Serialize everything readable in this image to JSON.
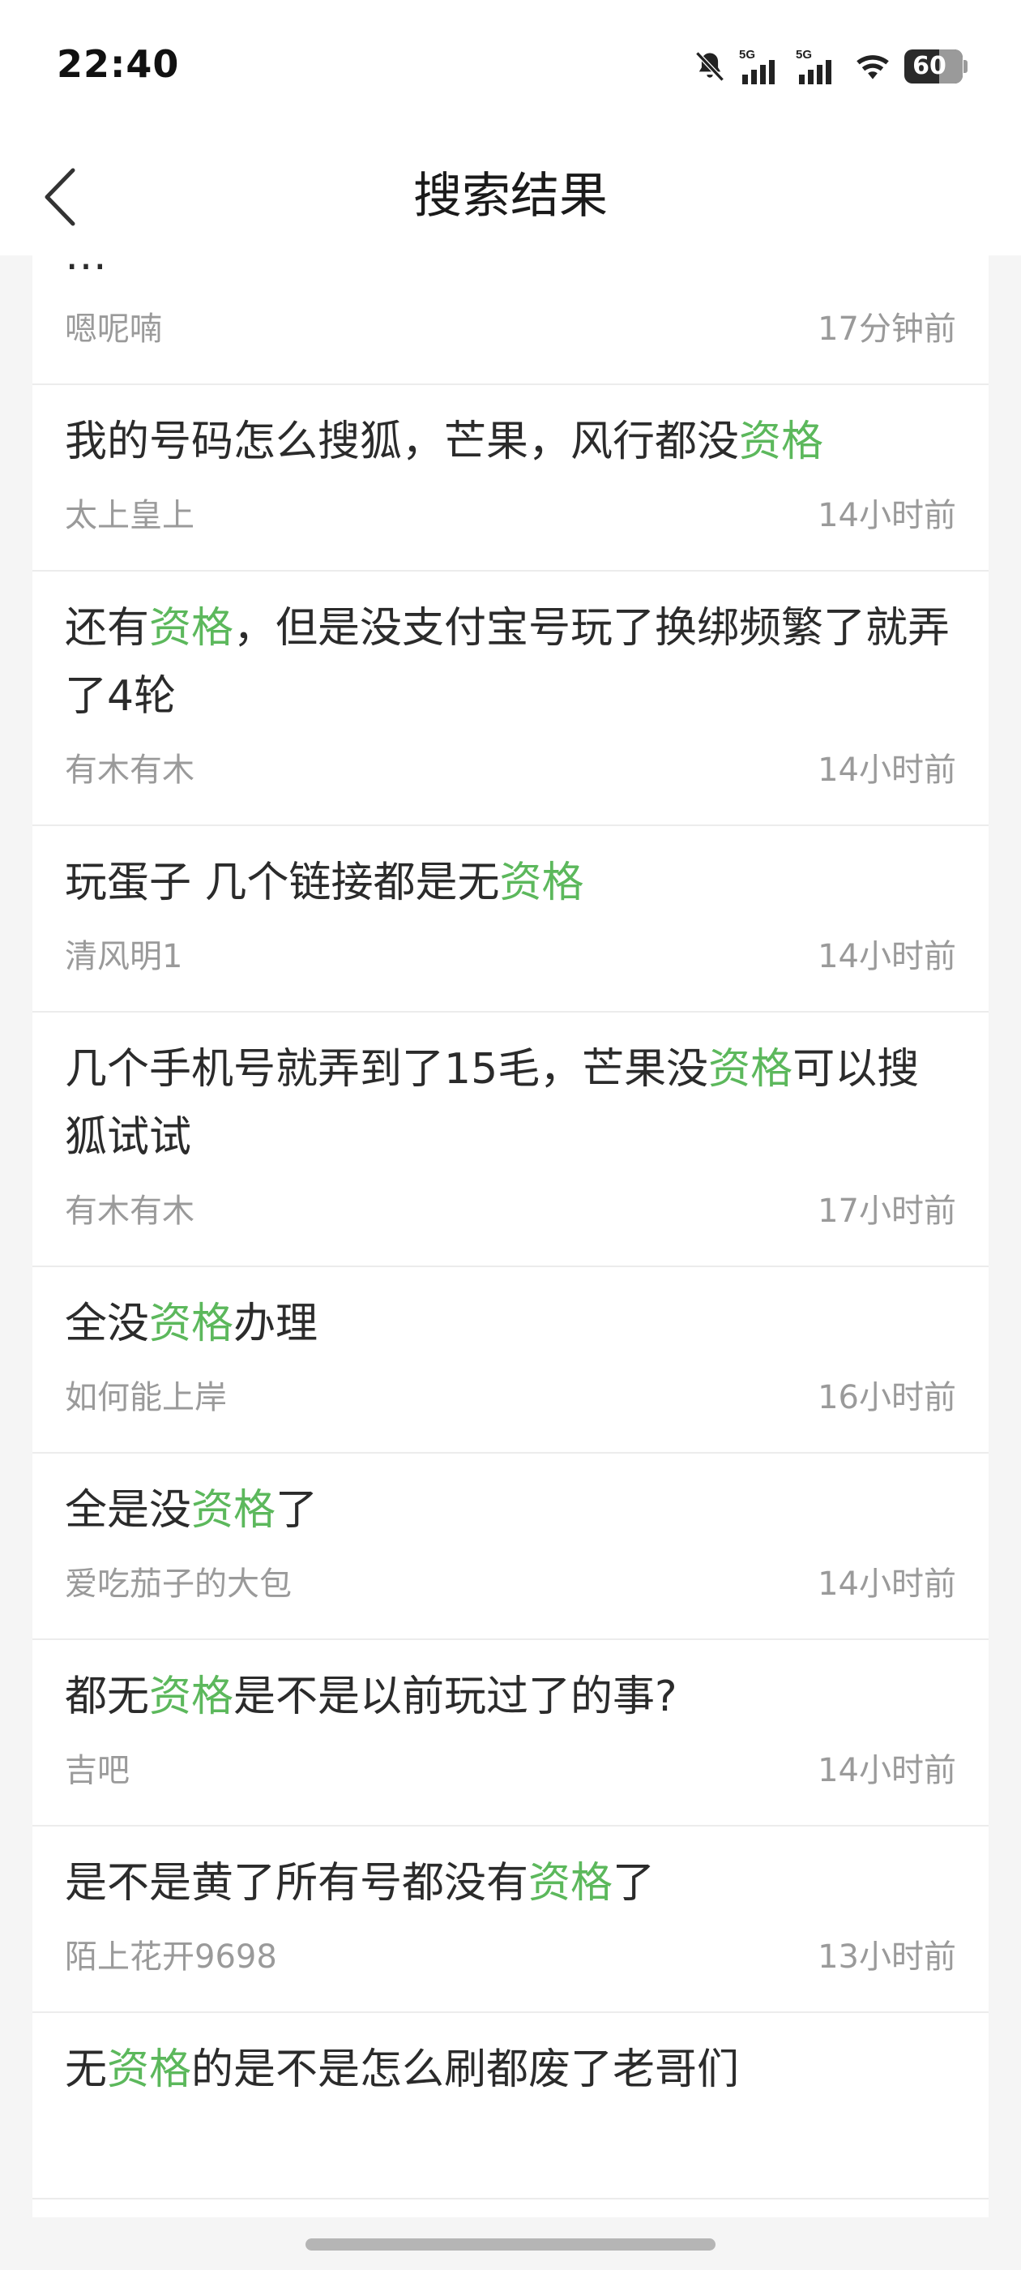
{
  "status_bar": {
    "time": "22:40",
    "network_1": "5G",
    "network_2": "5G",
    "battery": "60"
  },
  "header": {
    "title": "搜索结果"
  },
  "results": [
    {
      "title_parts": [
        {
          "text": "…",
          "hl": false
        }
      ],
      "author": "嗯呢喃",
      "time": "17分钟前"
    },
    {
      "title_parts": [
        {
          "text": "我的号码怎么搜狐，芒果，风行都没",
          "hl": false
        },
        {
          "text": "资格",
          "hl": true
        }
      ],
      "author": "太上皇上",
      "time": "14小时前"
    },
    {
      "title_parts": [
        {
          "text": "还有",
          "hl": false
        },
        {
          "text": "资格",
          "hl": true
        },
        {
          "text": "，但是没支付宝号玩了换绑频繁了就弄了4轮",
          "hl": false
        }
      ],
      "author": "有木有木",
      "time": "14小时前"
    },
    {
      "title_parts": [
        {
          "text": "玩蛋子 几个链接都是无",
          "hl": false
        },
        {
          "text": "资格",
          "hl": true
        }
      ],
      "author": "清风明1",
      "time": "14小时前"
    },
    {
      "title_parts": [
        {
          "text": "几个手机号就弄到了15毛，芒果没",
          "hl": false
        },
        {
          "text": "资格",
          "hl": true
        },
        {
          "text": "可以搜狐试试",
          "hl": false
        }
      ],
      "author": "有木有木",
      "time": "17小时前"
    },
    {
      "title_parts": [
        {
          "text": "全没",
          "hl": false
        },
        {
          "text": "资格",
          "hl": true
        },
        {
          "text": "办理",
          "hl": false
        }
      ],
      "author": "如何能上岸",
      "time": "16小时前"
    },
    {
      "title_parts": [
        {
          "text": "全是没",
          "hl": false
        },
        {
          "text": "资格",
          "hl": true
        },
        {
          "text": "了",
          "hl": false
        }
      ],
      "author": "爱吃茄子的大包",
      "time": "14小时前"
    },
    {
      "title_parts": [
        {
          "text": "都无",
          "hl": false
        },
        {
          "text": "资格",
          "hl": true
        },
        {
          "text": "是不是以前玩过了的事?",
          "hl": false
        }
      ],
      "author": "吉吧",
      "time": "14小时前"
    },
    {
      "title_parts": [
        {
          "text": "是不是黄了所有号都没有",
          "hl": false
        },
        {
          "text": "资格",
          "hl": true
        },
        {
          "text": "了",
          "hl": false
        }
      ],
      "author": "陌上花开9698",
      "time": "13小时前"
    },
    {
      "title_parts": [
        {
          "text": "无",
          "hl": false
        },
        {
          "text": "资格",
          "hl": true
        },
        {
          "text": "的是不是怎么刷都废了老哥们",
          "hl": false
        }
      ],
      "author": "",
      "time": ""
    }
  ],
  "colors": {
    "highlight": "#5cb85c",
    "title_text": "#2b2b2b",
    "meta_text": "#9a9a9a"
  },
  "icons": {
    "back": "chevron-left-icon",
    "mute": "bell-off-icon",
    "signal": "cellular-signal-icon",
    "wifi": "wifi-icon",
    "battery": "battery-icon"
  }
}
